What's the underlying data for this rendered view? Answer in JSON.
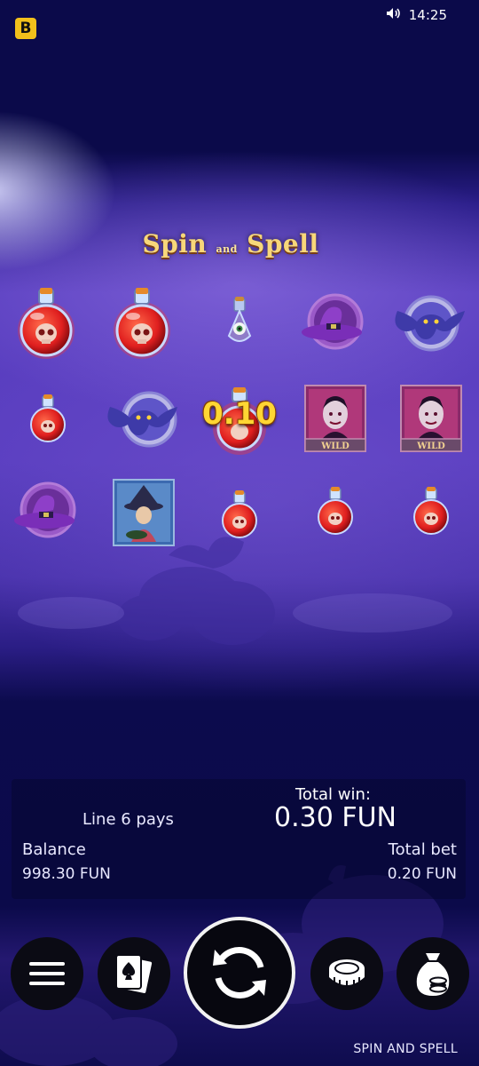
{
  "status_bar": {
    "brand_letter": "B",
    "time": "14:25",
    "volume_icon": "volume-icon"
  },
  "game": {
    "logo_text_left": "Spin",
    "logo_text_mid": "and",
    "logo_text_right": "Spell",
    "win_overlay": "0.10",
    "reels": [
      [
        "potion-red-skull-large",
        "potion-red-skull-small",
        "witch-hat"
      ],
      [
        "potion-red-skull-large",
        "bat",
        "witch-card"
      ],
      [
        "potion-eyeball",
        "potion-red-skull-winning",
        "potion-red-skull-small"
      ],
      [
        "witch-hat",
        "vampire-wild",
        "potion-red-skull-small"
      ],
      [
        "bat",
        "vampire-wild",
        "potion-red-skull-small"
      ]
    ],
    "wild_label": "WILD"
  },
  "info": {
    "line_pays": "Line 6 pays",
    "total_win_label": "Total win:",
    "total_win_value": "0.30 FUN",
    "balance_label": "Balance",
    "balance_value": "998.30 FUN",
    "total_bet_label": "Total bet",
    "total_bet_value": "0.20 FUN"
  },
  "controls": {
    "menu_icon": "menu-icon",
    "cards_icon": "playing-cards-icon",
    "spin_icon": "spin-arrows-icon",
    "coin_icon": "coin-stack-icon",
    "money_bag_icon": "money-bag-icon"
  },
  "footer": {
    "game_name": "SPIN AND SPELL"
  },
  "colors": {
    "background": "#0b0a4a",
    "brand_yellow": "#f2c01b",
    "win_gold": "#ffd633",
    "potion_red": "#e2201f",
    "purple": "#6a45c8"
  }
}
